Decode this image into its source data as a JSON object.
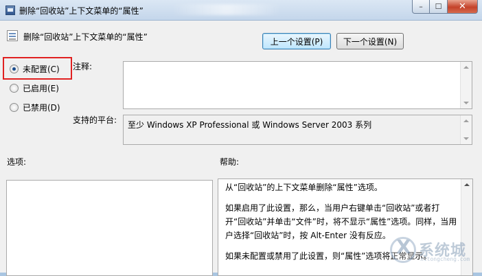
{
  "window": {
    "title": "删除“回收站”上下文菜单的“属性”",
    "controls": {
      "minimize": "–",
      "maximize": "☐",
      "close": "✕"
    }
  },
  "header": {
    "setting_title": "删除“回收站”上下文菜单的“属性”",
    "prev_button": "上一个设置(P)",
    "next_button": "下一个设置(N)"
  },
  "options": {
    "not_configured": "未配置(C)",
    "enabled": "已启用(E)",
    "disabled": "已禁用(D)",
    "selected": "not_configured"
  },
  "comment": {
    "label": "注释:",
    "value": ""
  },
  "platform": {
    "label": "支持的平台:",
    "value": "至少 Windows XP Professional 或 Windows Server 2003 系列"
  },
  "sections": {
    "options_label": "选项:",
    "help_label": "帮助:"
  },
  "help": {
    "p1": "从“回收站”的上下文菜单删除“属性”选项。",
    "p2": "如果启用了此设置，那么，当用户右键单击“回收站”或者打开“回收站”并单击“文件”时，将不显示“属性”选项。同样，当用户选择“回收站”时，按 Alt-Enter 没有反应。",
    "p3": "如果未配置或禁用了此设置，则“属性”选项将正常显示。"
  },
  "watermark": {
    "text": "系统城",
    "url": "xitongcheng.com"
  },
  "colors": {
    "highlight_box": "#e02020",
    "focused_button": "#3c7fb1",
    "titlebar": "#c4d6eb"
  }
}
